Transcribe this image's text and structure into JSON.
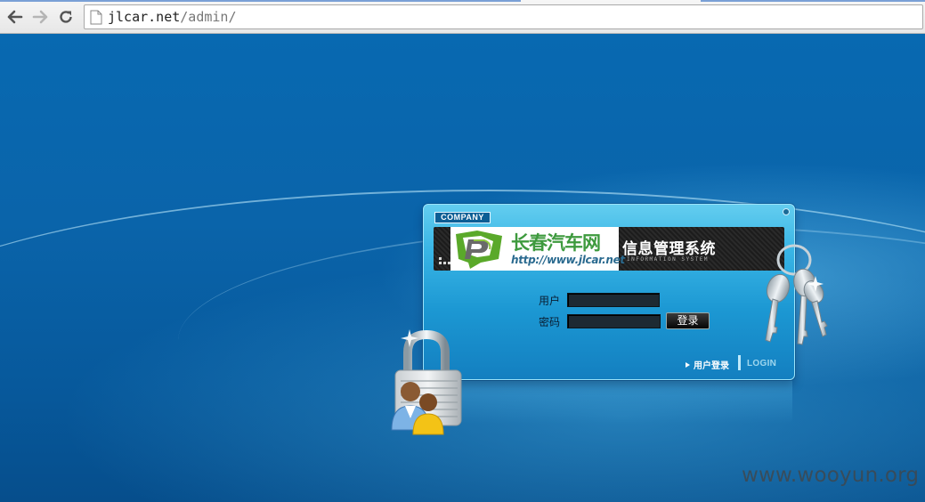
{
  "browser": {
    "url_host": "jlcar.net",
    "url_path": "/admin/"
  },
  "login": {
    "company_badge": "COMPANY",
    "logo_name": "长春汽车网",
    "logo_url": "http://www.jlcar.net",
    "system_title": "信息管理系统",
    "system_subtitle": "INFORMATION SYSTEM",
    "username_label": "用户",
    "password_label": "密码",
    "username_value": "",
    "password_value": "",
    "submit_label": "登录",
    "footer_link": "用户登录",
    "footer_login": "LOGIN"
  },
  "watermark": "www.wooyun.org",
  "colors": {
    "page_background": "#0a64aa",
    "panel": "#1c98d3",
    "logo_green": "#3e9a3e"
  },
  "icons": [
    "back-arrow-icon",
    "forward-arrow-icon",
    "reload-icon",
    "page-icon",
    "padlock-users-icon",
    "keys-icon"
  ]
}
